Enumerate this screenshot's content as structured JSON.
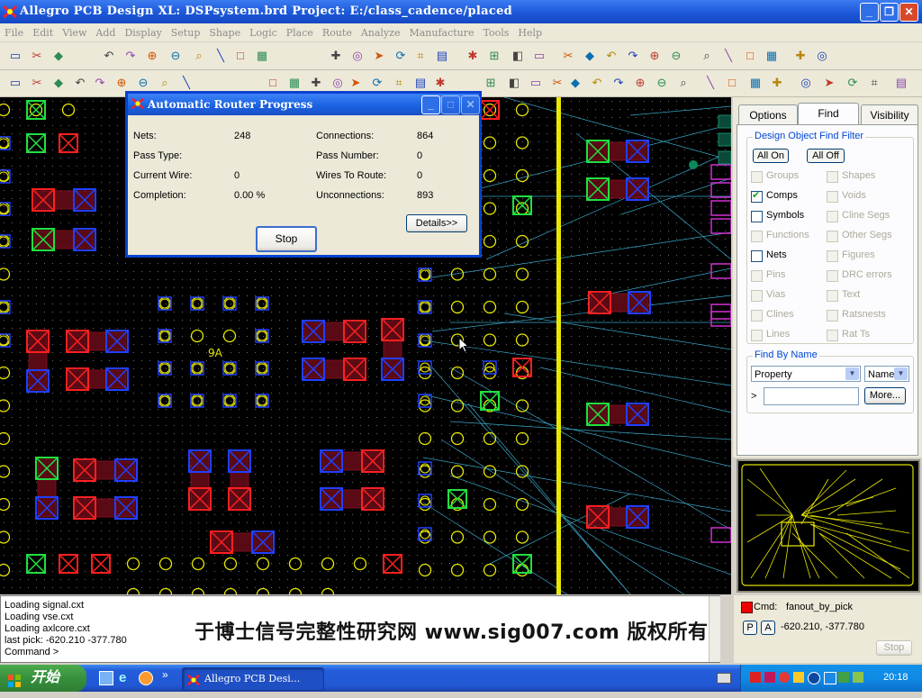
{
  "window": {
    "title": "Allegro PCB Design XL: DSPsystem.brd  Project: E:/class_cadence/placed",
    "minimize_label": "_",
    "maximize_label": "❐",
    "close_label": "✕"
  },
  "menu": [
    "File",
    "Edit",
    "View",
    "Add",
    "Display",
    "Setup",
    "Shape",
    "Logic",
    "Place",
    "Route",
    "Analyze",
    "Manufacture",
    "Tools",
    "Help"
  ],
  "canvas": {
    "ref_label": "9A",
    "background": "#000000",
    "pad_red": "#ff2020",
    "pad_blue": "#2040ff",
    "pad_green": "#20e040",
    "via_yellow": "#e8e800",
    "rat_color": "#3aa6c8"
  },
  "dialog": {
    "title": "Automatic Router Progress",
    "fields": {
      "nets_label": "Nets:",
      "nets_value": "248",
      "pass_type_label": "Pass Type:",
      "pass_type_value": "",
      "current_wire_label": "Current Wire:",
      "current_wire_value": "0",
      "completion_label": "Completion:",
      "completion_value": "0.00 %",
      "connections_label": "Connections:",
      "connections_value": "864",
      "pass_number_label": "Pass Number:",
      "pass_number_value": "0",
      "wires_to_route_label": "Wires To Route:",
      "wires_to_route_value": "0",
      "unconnections_label": "Unconnections:",
      "unconnections_value": "893"
    },
    "details_label": "Details>>",
    "stop_label": "Stop"
  },
  "panel": {
    "tabs": [
      "Options",
      "Find",
      "Visibility"
    ],
    "active_tab": "Find",
    "filter_title": "Design Object Find Filter",
    "all_on_label": "All On",
    "all_off_label": "All Off",
    "left_items": [
      {
        "label": "Groups",
        "checked": false,
        "enabled": false
      },
      {
        "label": "Comps",
        "checked": true,
        "enabled": true
      },
      {
        "label": "Symbols",
        "checked": false,
        "enabled": true
      },
      {
        "label": "Functions",
        "checked": false,
        "enabled": false
      },
      {
        "label": "Nets",
        "checked": false,
        "enabled": true
      },
      {
        "label": "Pins",
        "checked": false,
        "enabled": false
      },
      {
        "label": "Vias",
        "checked": false,
        "enabled": false
      },
      {
        "label": "Clines",
        "checked": false,
        "enabled": false
      },
      {
        "label": "Lines",
        "checked": false,
        "enabled": false
      }
    ],
    "right_items": [
      {
        "label": "Shapes",
        "checked": false,
        "enabled": false
      },
      {
        "label": "Voids",
        "checked": false,
        "enabled": false
      },
      {
        "label": "Cline Segs",
        "checked": false,
        "enabled": false
      },
      {
        "label": "Other Segs",
        "checked": false,
        "enabled": false
      },
      {
        "label": "Figures",
        "checked": false,
        "enabled": false
      },
      {
        "label": "DRC errors",
        "checked": false,
        "enabled": false
      },
      {
        "label": "Text",
        "checked": false,
        "enabled": false
      },
      {
        "label": "Ratsnests",
        "checked": false,
        "enabled": false
      },
      {
        "label": "Rat Ts",
        "checked": false,
        "enabled": false
      }
    ],
    "find_by_name_title": "Find By Name",
    "property_value": "Property",
    "name_value": "Name",
    "name_input_value": "",
    "more_label": "More...",
    "expand_label": ">"
  },
  "console": {
    "lines": [
      "Loading signal.cxt",
      "Loading vse.cxt",
      "Loading axlcore.cxt",
      "last pick:  -620.210  -377.780",
      "Command >"
    ]
  },
  "status": {
    "cmd_label": "Cmd:",
    "cmd_value": "fanout_by_pick",
    "p_label": "P",
    "a_label": "A",
    "coords": "-620.210, -377.780",
    "stop_label": "Stop"
  },
  "watermark": "于博士信号完整性研究网 www.sig007.com 版权所有",
  "taskbar": {
    "start_label": "开始",
    "task_label": "Allegro PCB Desi...",
    "quick_more": "»",
    "clock": "20:18"
  },
  "colors": {
    "titlebar": "#1a55d6",
    "dialog_border": "#0842d0",
    "find_link": "#0046d5"
  }
}
